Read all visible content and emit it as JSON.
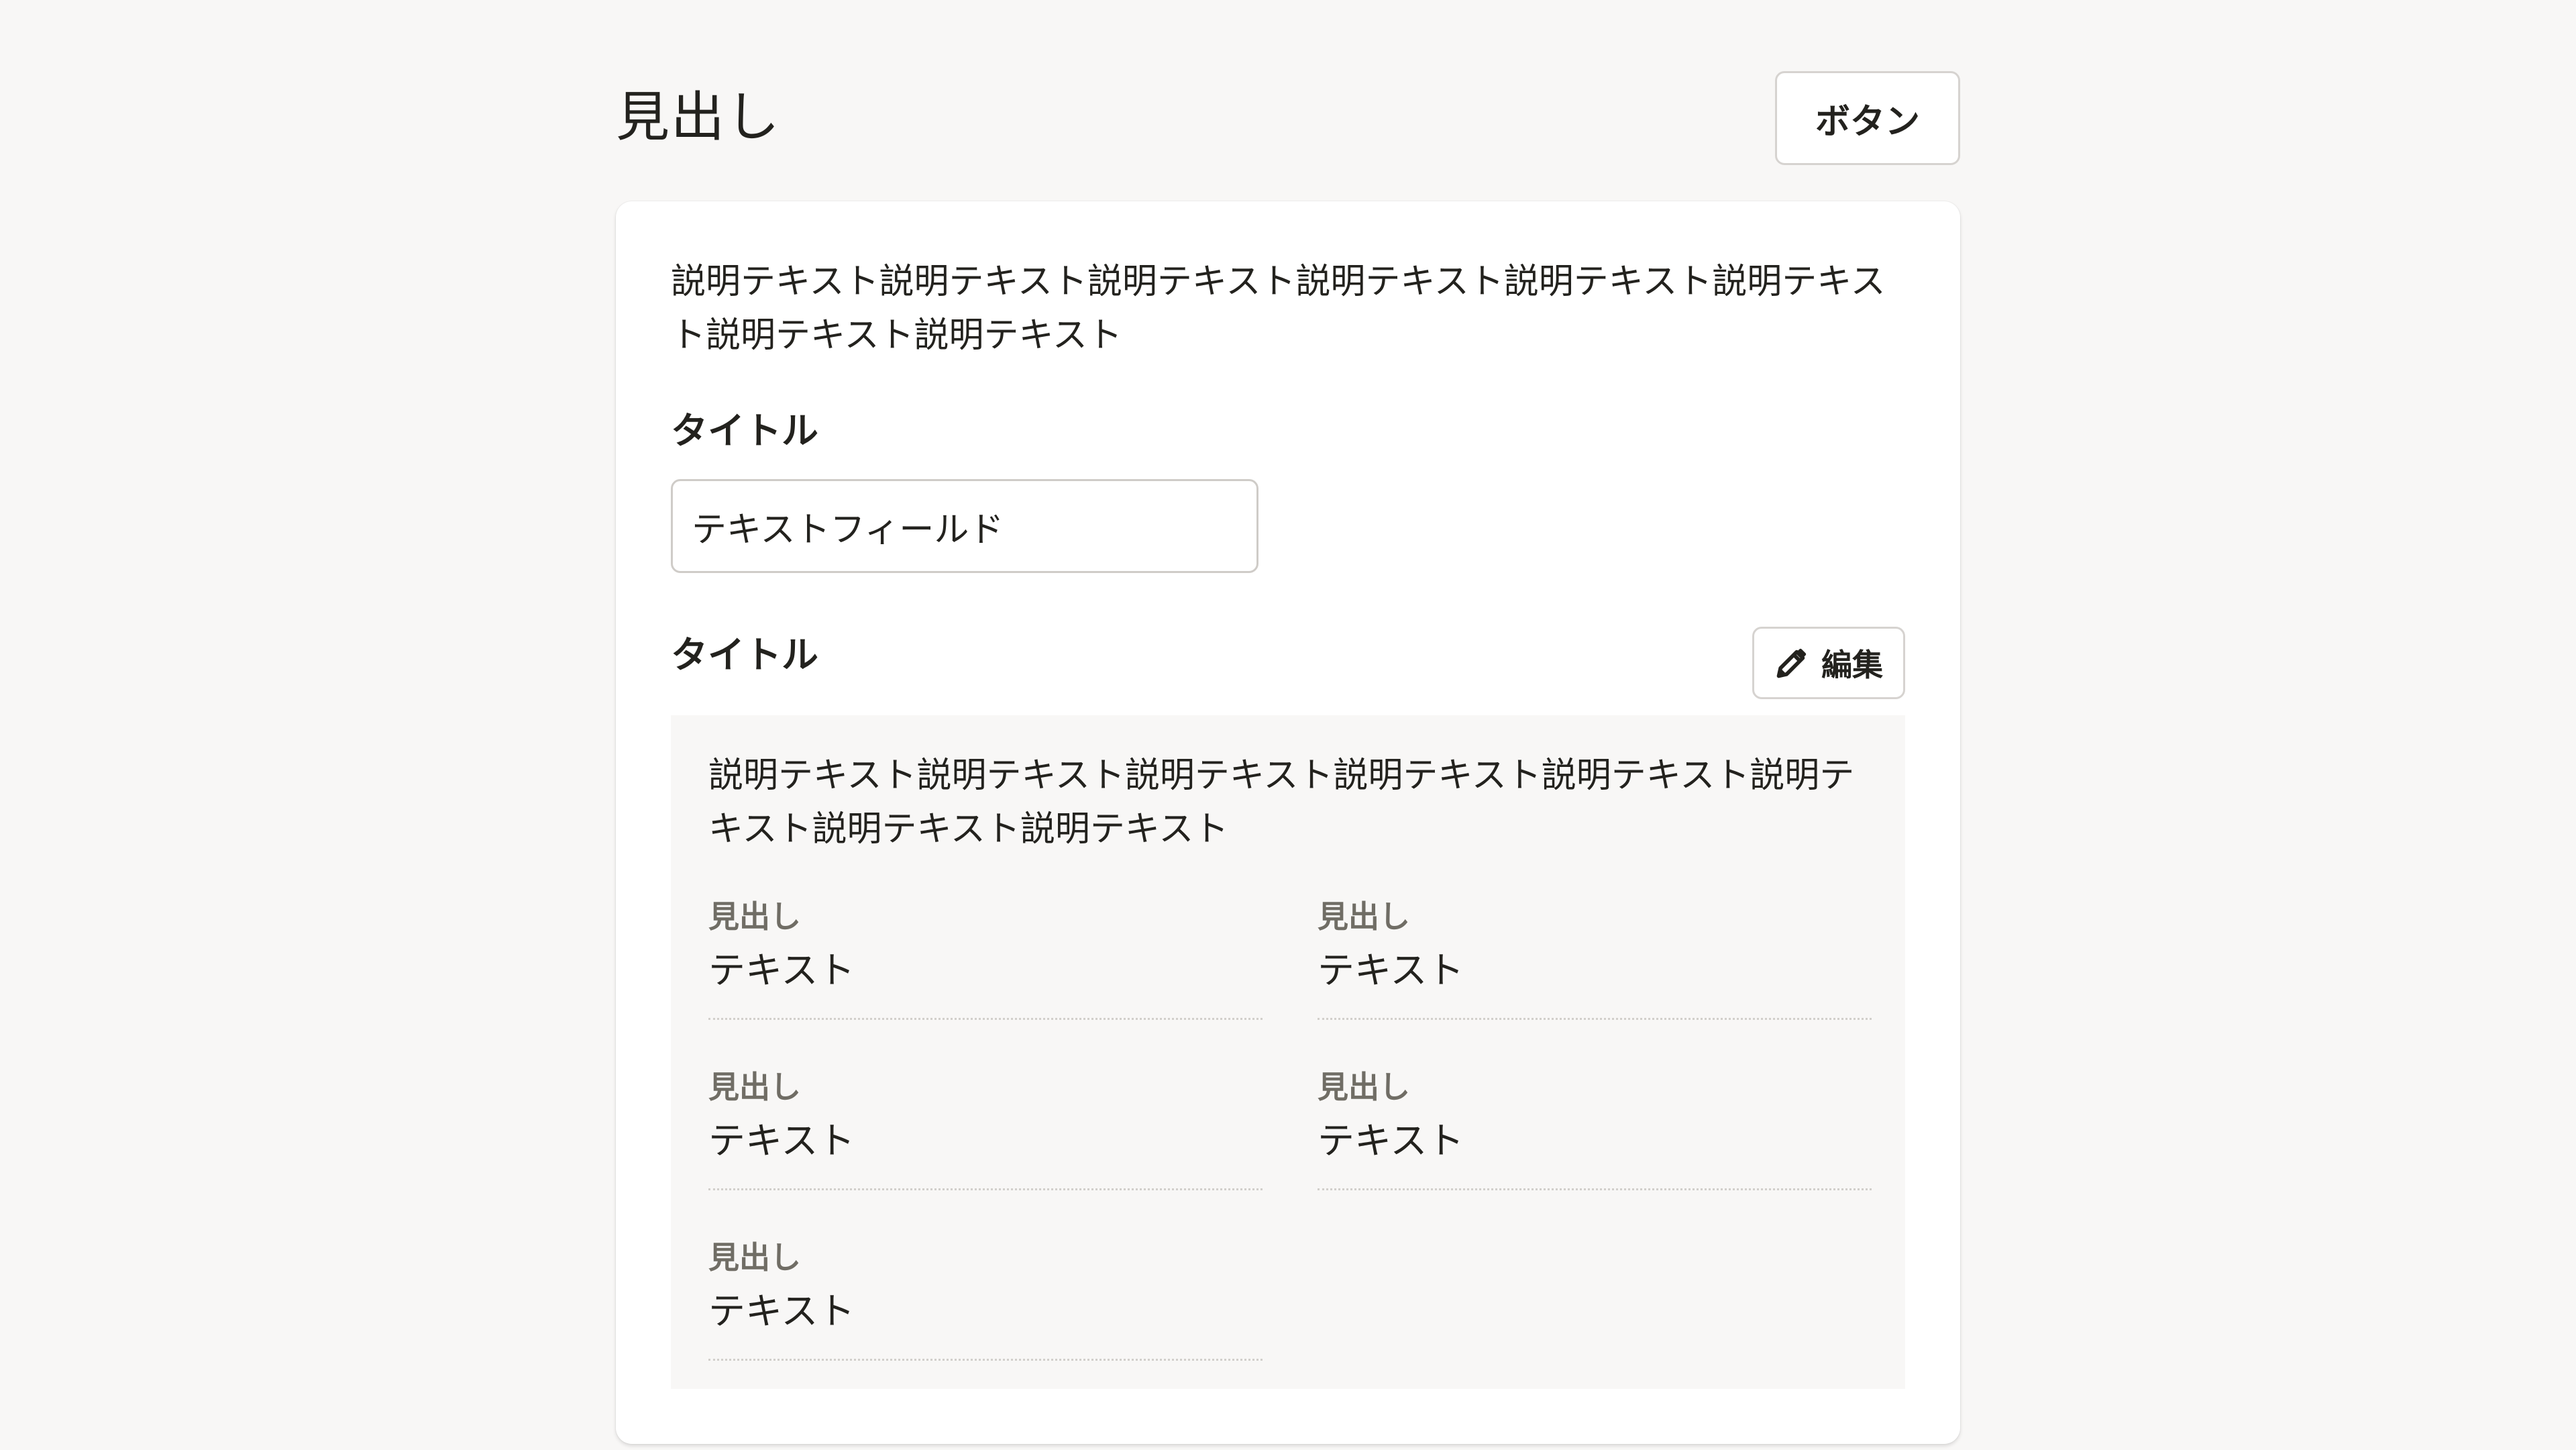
{
  "header": {
    "title": "見出し",
    "button_label": "ボタン"
  },
  "card": {
    "description": "説明テキスト説明テキスト説明テキスト説明テキスト説明テキスト説明テキスト説明テキスト説明テキスト",
    "field1": {
      "label": "タイトル",
      "value": "テキストフィールド"
    },
    "field2": {
      "label": "タイトル",
      "edit_label": "編集",
      "edit_icon": "pencil-icon"
    },
    "panel": {
      "description": "説明テキスト説明テキスト説明テキスト説明テキスト説明テキスト説明テキスト説明テキスト説明テキスト",
      "items": [
        {
          "term": "見出し",
          "value": "テキスト"
        },
        {
          "term": "見出し",
          "value": "テキスト"
        },
        {
          "term": "見出し",
          "value": "テキスト"
        },
        {
          "term": "見出し",
          "value": "テキスト"
        },
        {
          "term": "見出し",
          "value": "テキスト"
        }
      ]
    }
  }
}
